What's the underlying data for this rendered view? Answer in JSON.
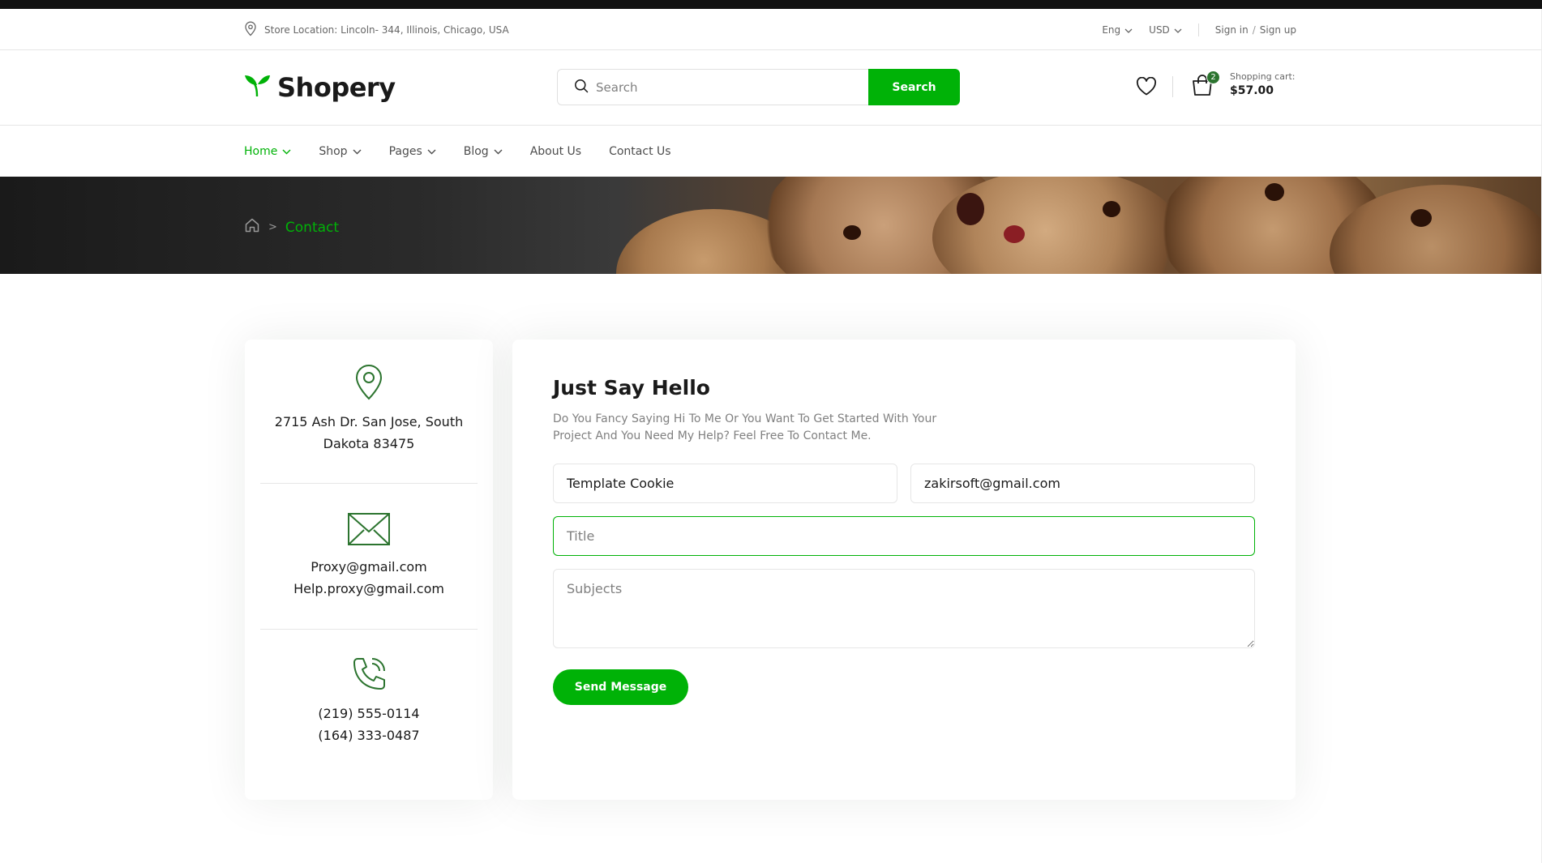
{
  "colors": {
    "accent": "#00b207",
    "dark_green": "#2c742f",
    "text": "#1a1a1a",
    "muted": "#808080"
  },
  "topbar": {
    "location_icon": "map-pin-icon",
    "location": "Store Location: Lincoln- 344, Illinois, Chicago, USA",
    "language": "Eng",
    "currency": "USD",
    "sign_in": "Sign in",
    "slash": "/",
    "sign_up": "Sign up"
  },
  "header": {
    "logo_icon": "leaf-icon",
    "logo": "Shopery",
    "search_placeholder": "Search",
    "search_button": "Search",
    "wishlist_icon": "heart-icon",
    "cart_icon": "shopping-bag-icon",
    "cart_count": "2",
    "cart_label": "Shopping cart:",
    "cart_total": "$57.00"
  },
  "nav": {
    "items": [
      {
        "label": "Home",
        "dropdown": true,
        "active": true
      },
      {
        "label": "Shop",
        "dropdown": true
      },
      {
        "label": "Pages",
        "dropdown": true
      },
      {
        "label": "Blog",
        "dropdown": true
      },
      {
        "label": "About Us"
      },
      {
        "label": "Contact Us"
      }
    ]
  },
  "breadcrumb": {
    "home_icon": "home-icon",
    "separator": ">",
    "current": "Contact"
  },
  "contact_info": {
    "address": {
      "icon": "map-pin-icon",
      "line1": "2715 Ash Dr. San Jose, South",
      "line2": "Dakota 83475"
    },
    "email": {
      "icon": "envelope-icon",
      "line1": "Proxy@gmail.com",
      "line2": "Help.proxy@gmail.com"
    },
    "phone": {
      "icon": "phone-icon",
      "line1": "(219) 555-0114",
      "line2": "(164) 333-0487"
    }
  },
  "form": {
    "title": "Just Say Hello",
    "subtitle": "Do You Fancy Saying Hi To Me Or You Want To Get Started With Your Project And You Need My Help? Feel Free To Contact Me.",
    "name_value": "Template Cookie",
    "email_value": "zakirsoft@gmail.com",
    "title_placeholder": "Title",
    "subjects_placeholder": "Subjects",
    "send_button": "Send Message"
  }
}
